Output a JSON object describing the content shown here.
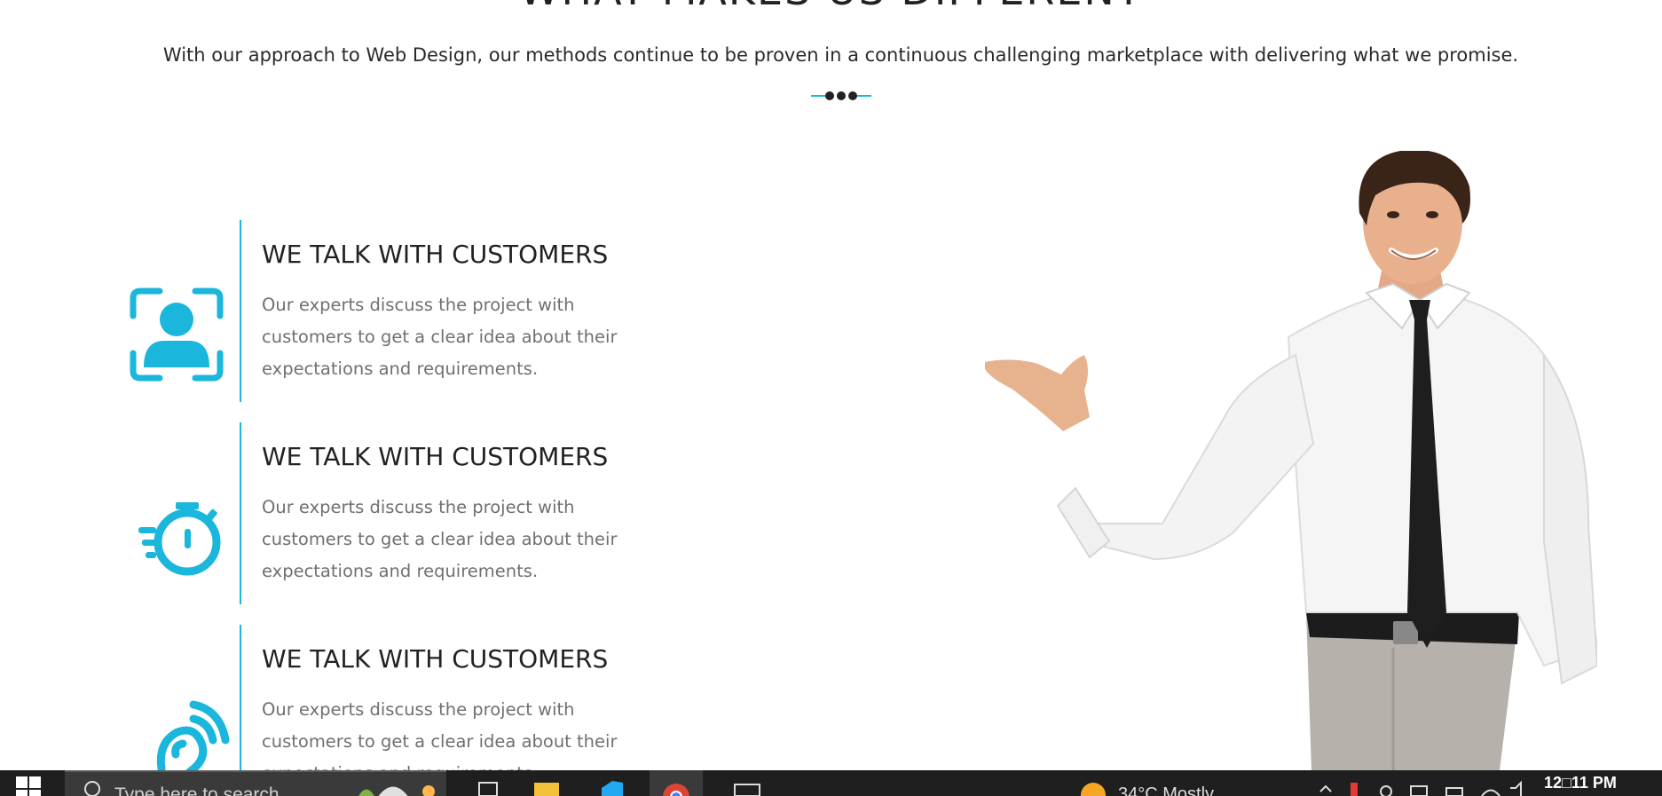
{
  "section": {
    "heading": "WHAT MAKES US DIFFERENT",
    "subtitle": "With our approach to Web Design, our methods continue to be proven in a continuous challenging marketplace with delivering what we promise."
  },
  "features": [
    {
      "title": "WE TALK WITH CUSTOMERS",
      "description": "Our experts discuss the project with customers to get a clear idea about their expectations and requirements.",
      "icon": "user-focus-icon"
    },
    {
      "title": "WE TALK WITH CUSTOMERS",
      "description": "Our experts discuss the project with customers to get a clear idea about their expectations and requirements.",
      "icon": "fast-stopwatch-icon"
    },
    {
      "title": "WE TALK WITH CUSTOMERS",
      "description": "Our experts discuss the project with customers to get a clear idea about their expectations and requirements.",
      "icon": "hearing-icon"
    }
  ],
  "colors": {
    "accent": "#1ab6db",
    "heading": "#222222",
    "body_text": "#707070",
    "taskbar": "#1f1f1f"
  },
  "taskbar": {
    "search_placeholder": "Type here to search",
    "weather": "34°C  Mostly",
    "clock": "12□11 PM",
    "apps": [
      "task-view-icon",
      "file-explorer-icon",
      "vscode-icon",
      "chrome-icon",
      "terminal-icon"
    ]
  }
}
